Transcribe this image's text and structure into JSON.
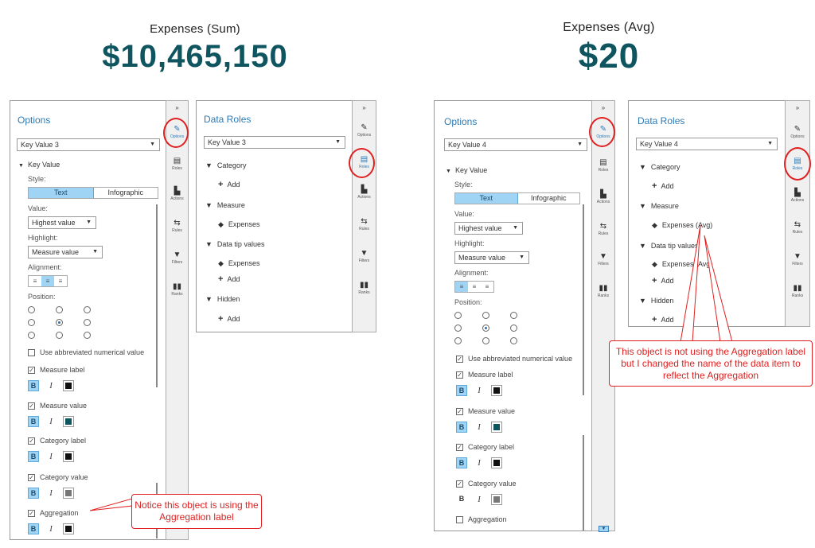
{
  "kpi_left": {
    "label": "Expenses (Sum)",
    "value": "$10,465,150"
  },
  "kpi_right": {
    "label": "Expenses (Avg)",
    "value": "$20"
  },
  "left_options": {
    "title": "Options",
    "dropdown": "Key Value 3",
    "section": "Key Value",
    "style_label": "Style:",
    "style_text": "Text",
    "style_infographic": "Infographic",
    "value_label": "Value:",
    "value_select": "Highest value",
    "highlight_label": "Highlight:",
    "highlight_select": "Measure value",
    "alignment_label": "Alignment:",
    "position_label": "Position:",
    "abbrev_label": "Use abbreviated numerical value",
    "measure_label": "Measure label",
    "measure_value": "Measure value",
    "category_label": "Category label",
    "category_value": "Category value",
    "aggregation": "Aggregation"
  },
  "left_roles": {
    "title": "Data Roles",
    "dropdown": "Key Value 3",
    "category": "Category",
    "measure": "Measure",
    "measure_item": "Expenses",
    "tips": "Data tip values",
    "tips_item": "Expenses",
    "hidden": "Hidden",
    "add": "Add"
  },
  "right_options": {
    "title": "Options",
    "dropdown": "Key Value 4",
    "section": "Key Value",
    "style_label": "Style:",
    "style_text": "Text",
    "style_infographic": "Infographic",
    "value_label": "Value:",
    "value_select": "Highest value",
    "highlight_label": "Highlight:",
    "highlight_select": "Measure value",
    "alignment_label": "Alignment:",
    "position_label": "Position:",
    "abbrev_label": "Use abbreviated numerical value",
    "measure_label": "Measure label",
    "measure_value": "Measure value",
    "category_label": "Category label",
    "category_value": "Category value",
    "aggregation": "Aggregation"
  },
  "right_roles": {
    "title": "Data Roles",
    "dropdown": "Key Value 4",
    "category": "Category",
    "measure": "Measure",
    "measure_item": "Expenses (Avg)",
    "tips": "Data tip values",
    "tips_item": "Expenses (Avg)",
    "hidden": "Hidden",
    "add": "Add"
  },
  "strip_tools": {
    "options": "Options",
    "roles": "Roles",
    "actions": "Actions",
    "rules": "Rules",
    "filters": "Filters",
    "ranks": "Ranks",
    "collapse": "»"
  },
  "callout_left": "Notice this object is using the Aggregation label",
  "callout_right": "This object is not using the Aggregation label but I changed the name of the data item to reflect the Aggregation",
  "colors": {
    "accent": "#2c7bb6",
    "kpi": "#0f5560",
    "annotation": "#e02020",
    "highlight": "#9fd4f4",
    "measure_swatch": "#0f5560",
    "dark_swatch": "#111111",
    "gray_swatch": "#777777"
  },
  "icons": {
    "options": "options-pencil-icon",
    "roles": "roles-icon",
    "actions": "actions-icon",
    "rules": "rules-icon",
    "filters": "funnel-icon",
    "ranks": "ranks-bars-icon",
    "measure": "measure-tag-icon",
    "add": "plus-icon"
  }
}
